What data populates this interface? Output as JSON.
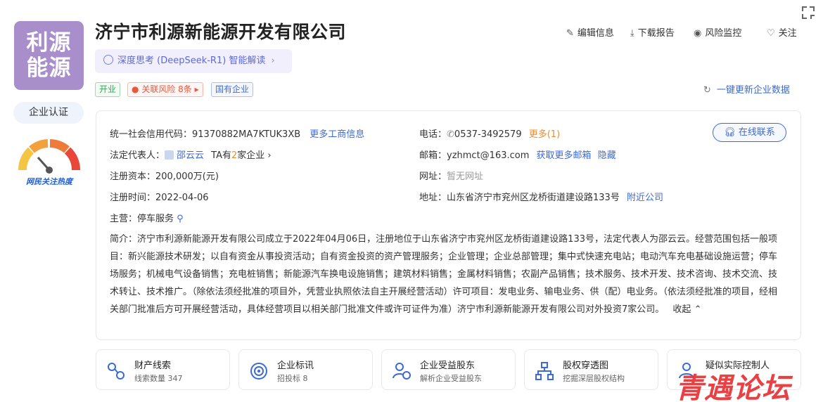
{
  "company": {
    "logo_text": "利源\n能源",
    "name": "济宁市利源新能源开发有限公司",
    "ai_interpret": "深度思考 (DeepSeek-R1) 智能解读",
    "tags": {
      "status": "开业",
      "risk": "关联风险 8条",
      "type": "国有企业"
    }
  },
  "left": {
    "cert_label": "企业认证",
    "heat_label": "网民关注热度"
  },
  "actions": {
    "edit": "编辑信息",
    "download": "下载报告",
    "monitor": "风险监控",
    "follow": "关注",
    "refresh": "一键更新企业数据"
  },
  "info": {
    "credit_code_label": "统一社会信用代码：",
    "credit_code": "91370882MA7KTUK3XB",
    "more_business": "更多工商信息",
    "legal_rep_label": "法定代表人：",
    "legal_rep": "邵云云",
    "legal_rep_ta": "TA有",
    "legal_rep_count": "2",
    "legal_rep_suffix": "家企业",
    "capital_label": "注册资本：",
    "capital": "200,000万(元)",
    "reg_time_label": "注册时间：",
    "reg_time": "2022-04-06",
    "main_label": "主营：",
    "main": "停车服务",
    "phone_label": "电话：",
    "phone": "0537-3492579",
    "phone_more": "更多(1)",
    "email_label": "邮箱：",
    "email": "yzhmct@163.com",
    "email_more": "获取更多邮箱",
    "email_hide": "隐藏",
    "website_label": "网址：",
    "website": "暂无网址",
    "address_label": "地址：",
    "address": "山东省济宁市兖州区龙桥街道建设路133号",
    "address_nearby": "附近公司",
    "contact_button": "在线联系",
    "intro": "简介：济宁市利源新能源开发有限公司成立于2022年04月06日，注册地位于山东省济宁市兖州区龙桥街道建设路133号，法定代表人为邵云云。经营范围包括一般项目：新兴能源技术研发；以自有资金从事投资活动；自有资金投资的资产管理服务；企业管理；企业总部管理；集中式快速充电站；电动汽车充电基础设施运营；停车场服务；机械电气设备销售；充电桩销售；新能源汽车换电设施销售；建筑材料销售；金属材料销售；农副产品销售；技术服务、技术开发、技术咨询、技术交流、技术转让、技术推广。（除依法须经批准的项目外，凭营业执照依法自主开展经营活动）许可项目：发电业务、输电业务、供（配）电业务。（依法须经批准的项目，经相关部门批准后方可开展经营活动，具体经营项目以相关部门批准文件或许可证件为准）济宁市利源新能源开发有限公司对外投资7家公司。",
    "collapse": "收起"
  },
  "features": [
    {
      "title": "财产线索",
      "sub": "线索数量 347",
      "icon": "property-clue-icon"
    },
    {
      "title": "企业标讯",
      "sub": "招投标 8",
      "icon": "bid-target-icon"
    },
    {
      "title": "企业受益股东",
      "sub": "解析企业受益股东",
      "icon": "beneficiary-icon"
    },
    {
      "title": "股权穿透图",
      "sub": "挖掘深层股权结构",
      "icon": "equity-tree-icon"
    },
    {
      "title": "疑似实际控制人",
      "sub": "",
      "icon": "controller-icon"
    }
  ],
  "watermark": "青遇论坛",
  "colors": {
    "accent": "#3b6ad6",
    "logo_bg": "#a88fcc",
    "risk": "#e9573f",
    "open": "#3aa35b",
    "orange": "#f08b2b"
  }
}
